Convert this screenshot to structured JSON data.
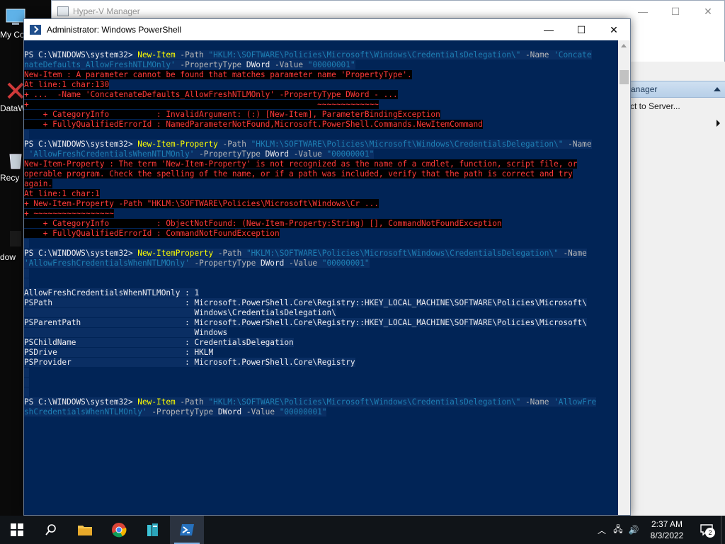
{
  "desktop": {
    "icons": [
      {
        "label": "My Co",
        "icon": "computer-icon"
      },
      {
        "label": "DataW",
        "icon": "app-icon"
      },
      {
        "label": "Recy",
        "icon": "recycle-bin-icon"
      },
      {
        "label": "dow",
        "icon": "file-icon"
      }
    ]
  },
  "hyperv": {
    "title": "Hyper-V Manager",
    "actions_label": "anager",
    "connect_label": "ct to Server..."
  },
  "powershell": {
    "title": "Administrator: Windows PowerShell",
    "lines": [
      {
        "cls": "sel",
        "segs": [
          [
            "pr",
            "PS C:\\WINDOWS\\system32> "
          ],
          [
            "cmd",
            "New-Item"
          ],
          [
            "prm",
            " -Path "
          ],
          [
            "str",
            "\"HKLM:\\SOFTWARE\\Policies\\Microsoft\\Windows\\CredentialsDelegation\\\""
          ],
          [
            "prm",
            " -Name "
          ],
          [
            "str",
            "'Concate"
          ]
        ]
      },
      {
        "cls": "sel",
        "segs": [
          [
            "str",
            "nateDefaults_AllowFreshNTLMOnly'"
          ],
          [
            "prm",
            " -PropertyType "
          ],
          [
            "txt",
            "DWord"
          ],
          [
            "prm",
            " -Value "
          ],
          [
            "str",
            "\"00000001\""
          ]
        ]
      },
      {
        "cls": "",
        "segs": [
          [
            "err",
            "New-Item : A parameter cannot be found that matches parameter name 'PropertyType'."
          ]
        ]
      },
      {
        "cls": "",
        "segs": [
          [
            "err",
            "At line:1 char:130"
          ]
        ]
      },
      {
        "cls": "",
        "segs": [
          [
            "err",
            "+ ...  -Name 'ConcatenateDefaults_AllowFreshNTLMOnly' -PropertyType DWord - ..."
          ]
        ]
      },
      {
        "cls": "",
        "segs": [
          [
            "err",
            "+                                                             ~~~~~~~~~~~~~"
          ]
        ]
      },
      {
        "cls": "",
        "segs": [
          [
            "err",
            "    + CategoryInfo          : InvalidArgument: (:) [New-Item], ParameterBindingException"
          ]
        ]
      },
      {
        "cls": "",
        "segs": [
          [
            "err",
            "    + FullyQualifiedErrorId : NamedParameterNotFound,Microsoft.PowerShell.Commands.NewItemCommand"
          ]
        ]
      },
      {
        "cls": "sel",
        "segs": [
          [
            "txt",
            " "
          ]
        ]
      },
      {
        "cls": "sel",
        "segs": [
          [
            "pr",
            "PS C:\\WINDOWS\\system32> "
          ],
          [
            "cmd",
            "New-Item-Property"
          ],
          [
            "prm",
            " -Path "
          ],
          [
            "str",
            "\"HKLM:\\SOFTWARE\\Policies\\Microsoft\\Windows\\CredentialsDelegation\\\""
          ],
          [
            "prm",
            " -Name"
          ]
        ]
      },
      {
        "cls": "sel",
        "segs": [
          [
            "str",
            " 'AllowFreshCredentialsWhenNTLMOnly'"
          ],
          [
            "prm",
            " -PropertyType "
          ],
          [
            "txt",
            "DWord"
          ],
          [
            "prm",
            " -Value "
          ],
          [
            "str",
            "\"00000001\""
          ]
        ]
      },
      {
        "cls": "",
        "segs": [
          [
            "err",
            "New-Item-Property : The term 'New-Item-Property' is not recognized as the name of a cmdlet, function, script file, or"
          ]
        ]
      },
      {
        "cls": "",
        "segs": [
          [
            "err",
            "operable program. Check the spelling of the name, or if a path was included, verify that the path is correct and try"
          ]
        ]
      },
      {
        "cls": "",
        "segs": [
          [
            "err",
            "again."
          ]
        ]
      },
      {
        "cls": "",
        "segs": [
          [
            "err",
            "At line:1 char:1"
          ]
        ]
      },
      {
        "cls": "",
        "segs": [
          [
            "err",
            "+ New-Item-Property -Path \"HKLM:\\SOFTWARE\\Policies\\Microsoft\\Windows\\Cr ..."
          ]
        ]
      },
      {
        "cls": "",
        "segs": [
          [
            "err",
            "+ ~~~~~~~~~~~~~~~~~"
          ]
        ]
      },
      {
        "cls": "",
        "segs": [
          [
            "err",
            "    + CategoryInfo          : ObjectNotFound: (New-Item-Property:String) [], CommandNotFoundException"
          ]
        ]
      },
      {
        "cls": "",
        "segs": [
          [
            "err",
            "    + FullyQualifiedErrorId : CommandNotFoundException"
          ]
        ]
      },
      {
        "cls": "sel",
        "segs": [
          [
            "txt",
            " "
          ]
        ]
      },
      {
        "cls": "sel",
        "segs": [
          [
            "pr",
            "PS C:\\WINDOWS\\system32> "
          ],
          [
            "cmd",
            "New-ItemProperty"
          ],
          [
            "prm",
            " -Path "
          ],
          [
            "str",
            "\"HKLM:\\SOFTWARE\\Policies\\Microsoft\\Windows\\CredentialsDelegation\\\""
          ],
          [
            "prm",
            " -Name"
          ]
        ]
      },
      {
        "cls": "sel",
        "segs": [
          [
            "str",
            "'AllowFreshCredentialsWhenNTLMOnly'"
          ],
          [
            "prm",
            " -PropertyType "
          ],
          [
            "txt",
            "DWord"
          ],
          [
            "prm",
            " -Value "
          ],
          [
            "str",
            "\"00000001\""
          ]
        ]
      },
      {
        "cls": "sel",
        "segs": [
          [
            "txt",
            " "
          ]
        ]
      },
      {
        "cls": "sel",
        "segs": [
          [
            "txt",
            " "
          ]
        ]
      },
      {
        "cls": "sel",
        "segs": [
          [
            "txt",
            "AllowFreshCredentialsWhenNTLMOnly : 1"
          ]
        ]
      },
      {
        "cls": "sel",
        "segs": [
          [
            "txt",
            "PSPath                            : Microsoft.PowerShell.Core\\Registry::HKEY_LOCAL_MACHINE\\SOFTWARE\\Policies\\Microsoft\\"
          ]
        ]
      },
      {
        "cls": "sel",
        "segs": [
          [
            "txt",
            "                                    Windows\\CredentialsDelegation\\"
          ]
        ]
      },
      {
        "cls": "sel",
        "segs": [
          [
            "txt",
            "PSParentPath                      : Microsoft.PowerShell.Core\\Registry::HKEY_LOCAL_MACHINE\\SOFTWARE\\Policies\\Microsoft\\"
          ]
        ]
      },
      {
        "cls": "sel",
        "segs": [
          [
            "txt",
            "                                    Windows"
          ]
        ]
      },
      {
        "cls": "sel",
        "segs": [
          [
            "txt",
            "PSChildName                       : CredentialsDelegation"
          ]
        ]
      },
      {
        "cls": "sel",
        "segs": [
          [
            "txt",
            "PSDrive                           : HKLM"
          ]
        ]
      },
      {
        "cls": "sel",
        "segs": [
          [
            "txt",
            "PSProvider                        : Microsoft.PowerShell.Core\\Registry"
          ]
        ]
      },
      {
        "cls": "sel",
        "segs": [
          [
            "txt",
            " "
          ]
        ]
      },
      {
        "cls": "sel",
        "segs": [
          [
            "txt",
            " "
          ]
        ]
      },
      {
        "cls": "sel",
        "segs": [
          [
            "txt",
            " "
          ]
        ]
      },
      {
        "cls": "sel",
        "segs": [
          [
            "pr",
            "PS C:\\WINDOWS\\system32> "
          ],
          [
            "cmd",
            "New-Item"
          ],
          [
            "prm",
            " -Path "
          ],
          [
            "str",
            "\"HKLM:\\SOFTWARE\\Policies\\Microsoft\\Windows\\CredentialsDelegation\\\""
          ],
          [
            "prm",
            " -Name "
          ],
          [
            "str",
            "'AllowFre"
          ]
        ]
      },
      {
        "cls": "sel",
        "segs": [
          [
            "str",
            "shCredentialsWhenNTLMOnly'"
          ],
          [
            "prm",
            " -PropertyType "
          ],
          [
            "txt",
            "DWord"
          ],
          [
            "prm",
            " -Value "
          ],
          [
            "str",
            "\"00000001\""
          ]
        ]
      }
    ]
  },
  "taskbar": {
    "apps": [
      {
        "name": "search",
        "icon": "search-icon"
      },
      {
        "name": "file-explorer",
        "icon": "folder-icon"
      },
      {
        "name": "chrome",
        "icon": "chrome-icon"
      },
      {
        "name": "hyper-v",
        "icon": "server-icon"
      },
      {
        "name": "powershell",
        "icon": "powershell-icon",
        "active": true
      }
    ],
    "time": "2:37 AM",
    "date": "8/3/2022",
    "notifications": "2"
  }
}
